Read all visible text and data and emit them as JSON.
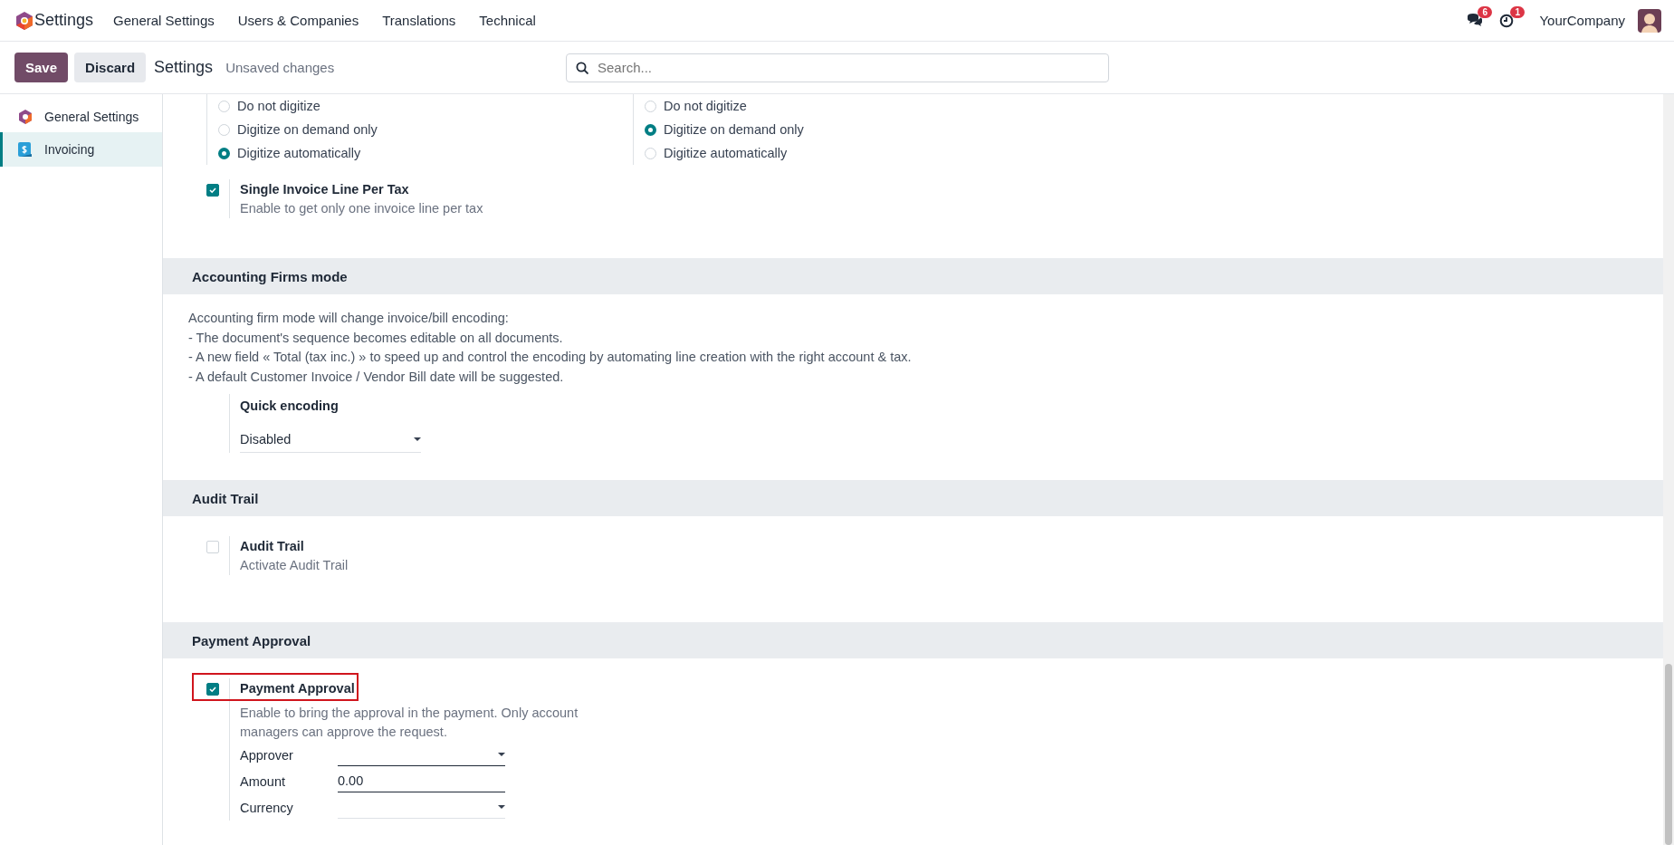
{
  "topbar": {
    "app_name": "Settings",
    "menu": [
      "General Settings",
      "Users & Companies",
      "Translations",
      "Technical"
    ],
    "messages_count": "6",
    "activities_count": "1",
    "company": "YourCompany"
  },
  "control_panel": {
    "save": "Save",
    "discard": "Discard",
    "title": "Settings",
    "status": "Unsaved changes",
    "search_placeholder": "Search..."
  },
  "sidebar": {
    "items": [
      {
        "label": "General Settings",
        "kind": "general",
        "selected": false
      },
      {
        "label": "Invoicing",
        "kind": "invoicing",
        "selected": true
      }
    ]
  },
  "sections": [
    {
      "blocks": [
        {
          "kind": "radio_columns",
          "columns": [
            {
              "options": [
                {
                  "label": "Do not digitize",
                  "selected": false
                },
                {
                  "label": "Digitize on demand only",
                  "selected": false
                },
                {
                  "label": "Digitize automatically",
                  "selected": true
                }
              ]
            },
            {
              "options": [
                {
                  "label": "Do not digitize",
                  "selected": false
                },
                {
                  "label": "Digitize on demand only",
                  "selected": true
                },
                {
                  "label": "Digitize automatically",
                  "selected": false
                }
              ]
            }
          ]
        },
        {
          "kind": "checkbox",
          "label": "Single Invoice Line Per Tax",
          "description": "Enable to get only one invoice line per tax",
          "checked": true,
          "highlighted": false
        }
      ]
    },
    {
      "title": "Accounting Firms mode",
      "blocks": [
        {
          "kind": "note",
          "lines": [
            "Accounting firm mode will change invoice/bill encoding:",
            "- The document's sequence becomes editable on all documents.",
            "- A new field « Total (tax inc.) » to speed up and control the encoding by automating line creation with the right account & tax.",
            "- A default Customer Invoice / Vendor Bill date will be suggested."
          ]
        },
        {
          "kind": "select",
          "label": "Quick encoding",
          "value": "Disabled"
        }
      ]
    },
    {
      "title": "Audit Trail",
      "blocks": [
        {
          "kind": "checkbox",
          "label": "Audit Trail",
          "description": "Activate Audit Trail",
          "checked": false,
          "highlighted": false
        }
      ]
    },
    {
      "title": "Payment Approval",
      "blocks": [
        {
          "kind": "checkbox",
          "label": "Payment Approval",
          "description": "Enable to bring the approval in the payment. Only account managers can approve the request.",
          "checked": true,
          "highlighted": true,
          "fields": [
            {
              "kind": "select",
              "label": "Approver"
            },
            {
              "kind": "input",
              "label": "Amount",
              "value": "0.00"
            },
            {
              "kind": "select",
              "label": "Currency"
            }
          ]
        }
      ]
    }
  ]
}
